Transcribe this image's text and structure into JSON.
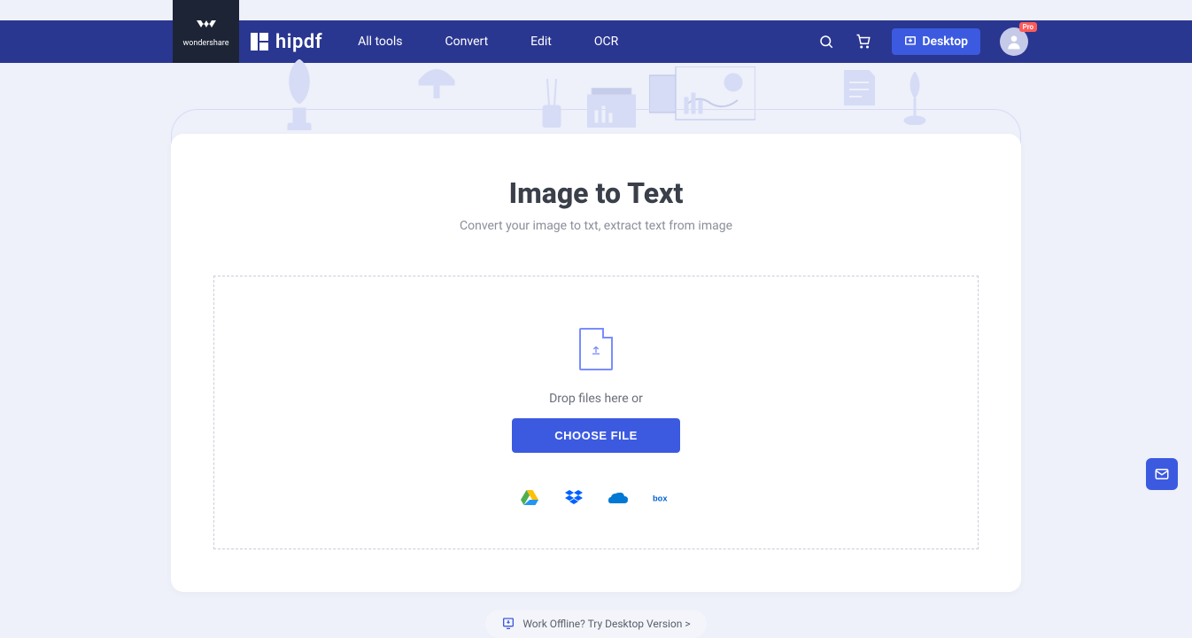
{
  "brand": {
    "parent": "wondershare",
    "name": "hipdf"
  },
  "nav": {
    "links": [
      "All tools",
      "Convert",
      "Edit",
      "OCR"
    ],
    "desktop_label": "Desktop",
    "pro_badge": "Pro"
  },
  "page": {
    "title": "Image to Text",
    "subtitle": "Convert your image to txt, extract text from image"
  },
  "dropzone": {
    "drop_text": "Drop files here or",
    "button_label": "CHOOSE FILE",
    "cloud_sources": [
      "google-drive",
      "dropbox",
      "onedrive",
      "box"
    ]
  },
  "offline_pill": "Work Offline? Try Desktop Version >"
}
